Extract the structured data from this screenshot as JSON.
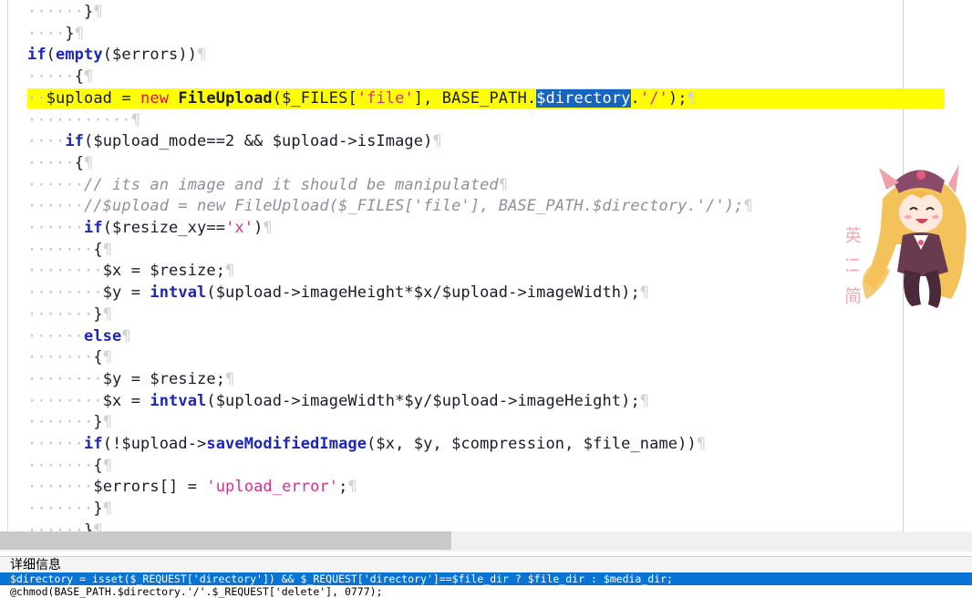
{
  "editor": {
    "lines": [
      {
        "indent": "······",
        "code": [
          {
            "c": "op",
            "t": "}"
          }
        ]
      },
      {
        "indent": "····",
        "code": [
          {
            "c": "op",
            "t": "}"
          }
        ]
      },
      {
        "indent": "",
        "code": [
          {
            "c": "kw",
            "t": "if"
          },
          {
            "c": "op",
            "t": "("
          },
          {
            "c": "fn",
            "t": "empty"
          },
          {
            "c": "op",
            "t": "("
          },
          {
            "c": "var",
            "t": "$errors"
          },
          {
            "c": "op",
            "t": "))"
          }
        ]
      },
      {
        "indent": "·····",
        "code": [
          {
            "c": "op",
            "t": "{"
          }
        ]
      },
      {
        "indent": "··",
        "current": true,
        "code": [
          {
            "c": "var",
            "t": "$upload = "
          },
          {
            "c": "new",
            "t": "new"
          },
          {
            "c": "var",
            "t": " "
          },
          {
            "c": "cls",
            "t": "FileUpload"
          },
          {
            "c": "op",
            "t": "("
          },
          {
            "c": "var",
            "t": "$_FILES["
          },
          {
            "c": "str",
            "t": "'file'"
          },
          {
            "c": "var",
            "t": "], BASE_PATH."
          },
          {
            "c": "sel",
            "t": "$directory"
          },
          {
            "c": "var",
            "t": "."
          },
          {
            "c": "str",
            "t": "'/'"
          },
          {
            "c": "op",
            "t": ");"
          }
        ]
      },
      {
        "indent": "···········",
        "code": []
      },
      {
        "indent": "····",
        "code": [
          {
            "c": "kw",
            "t": "if"
          },
          {
            "c": "op",
            "t": "("
          },
          {
            "c": "var",
            "t": "$upload_mode==2 && $upload->isImage"
          },
          {
            "c": "op",
            "t": ")"
          }
        ]
      },
      {
        "indent": "·····",
        "code": [
          {
            "c": "op",
            "t": "{"
          }
        ]
      },
      {
        "indent": "······",
        "code": [
          {
            "c": "cmt",
            "t": "// its an image and it should be manipulated"
          }
        ]
      },
      {
        "indent": "······",
        "code": [
          {
            "c": "cmt",
            "t": "//$upload = new FileUpload($_FILES['file'], BASE_PATH.$directory.'/');"
          }
        ]
      },
      {
        "indent": "······",
        "code": [
          {
            "c": "kw",
            "t": "if"
          },
          {
            "c": "op",
            "t": "("
          },
          {
            "c": "var",
            "t": "$resize_xy=="
          },
          {
            "c": "str",
            "t": "'x'"
          },
          {
            "c": "op",
            "t": ")"
          }
        ]
      },
      {
        "indent": "·······",
        "code": [
          {
            "c": "op",
            "t": "{"
          }
        ]
      },
      {
        "indent": "········",
        "code": [
          {
            "c": "var",
            "t": "$x = $resize;"
          }
        ]
      },
      {
        "indent": "········",
        "code": [
          {
            "c": "var",
            "t": "$y = "
          },
          {
            "c": "fn",
            "t": "intval"
          },
          {
            "c": "var",
            "t": "($upload->imageHeight*$x/$upload->imageWidth);"
          }
        ]
      },
      {
        "indent": "·······",
        "code": [
          {
            "c": "op",
            "t": "}"
          }
        ]
      },
      {
        "indent": "······",
        "code": [
          {
            "c": "kw",
            "t": "else"
          }
        ]
      },
      {
        "indent": "·······",
        "code": [
          {
            "c": "op",
            "t": "{"
          }
        ]
      },
      {
        "indent": "········",
        "code": [
          {
            "c": "var",
            "t": "$y = $resize;"
          }
        ]
      },
      {
        "indent": "········",
        "code": [
          {
            "c": "var",
            "t": "$x = "
          },
          {
            "c": "fn",
            "t": "intval"
          },
          {
            "c": "var",
            "t": "($upload->imageWidth*$y/$upload->imageHeight);"
          }
        ]
      },
      {
        "indent": "·······",
        "code": [
          {
            "c": "op",
            "t": "}"
          }
        ]
      },
      {
        "indent": "······",
        "code": [
          {
            "c": "kw",
            "t": "if"
          },
          {
            "c": "op",
            "t": "(!"
          },
          {
            "c": "var",
            "t": "$upload->"
          },
          {
            "c": "fn",
            "t": "saveModifiedImage"
          },
          {
            "c": "var",
            "t": "($x, $y, $compression, $file_name))"
          }
        ]
      },
      {
        "indent": "·······",
        "code": [
          {
            "c": "op",
            "t": "{"
          }
        ]
      },
      {
        "indent": "·······",
        "code": [
          {
            "c": "var",
            "t": "$errors[] = "
          },
          {
            "c": "str",
            "t": "'upload_error'"
          },
          {
            "c": "op",
            "t": ";"
          }
        ]
      },
      {
        "indent": "·······",
        "code": [
          {
            "c": "op",
            "t": "}"
          }
        ]
      },
      {
        "indent": "······",
        "code": [
          {
            "c": "op",
            "t": "}"
          }
        ]
      }
    ],
    "pilcrow": "¶",
    "mascot_text": "英 !! 简"
  },
  "output_panel": {
    "title": "详细信息",
    "lines": [
      "$directory = isset($_REQUEST['directory']) && $_REQUEST['directory']==$file_dir ? $file_dir : $media_dir;",
      "@chmod(BASE_PATH.$directory.'/'.$_REQUEST['delete'], 0777);"
    ]
  },
  "colors": {
    "keyword": "#1c27b8",
    "string": "#d42f95",
    "new_keyword": "#e0153d",
    "comment": "#8f8f9e",
    "current_line": "#ffff00",
    "selection": "#1665c0",
    "output_highlight": "#0a74d4"
  }
}
